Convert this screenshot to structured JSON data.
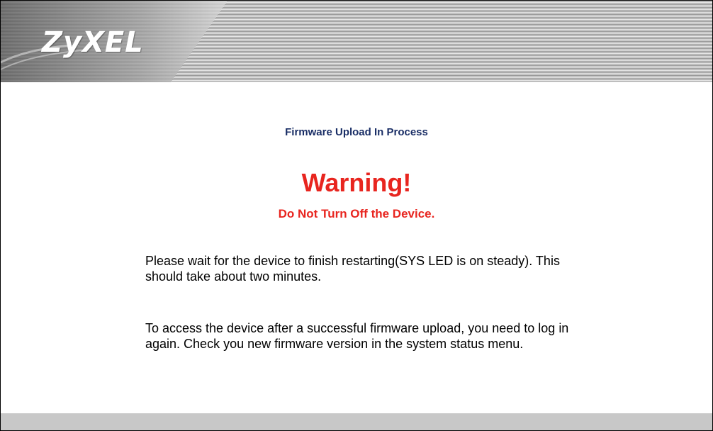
{
  "header": {
    "logo_text": "ZyXEL"
  },
  "content": {
    "title": "Firmware Upload In Process",
    "warning": "Warning!",
    "subwarning": "Do Not Turn Off the Device.",
    "paragraph1": "Please wait for the device to finish restarting(SYS LED is on steady). This should take about two minutes.",
    "paragraph2": "To access the device after a successful firmware upload, you need to log in again. Check you new firmware version in the system status menu."
  },
  "colors": {
    "title": "#1a2e66",
    "warning": "#e8251f",
    "footer_bar": "#c8c8c8"
  }
}
